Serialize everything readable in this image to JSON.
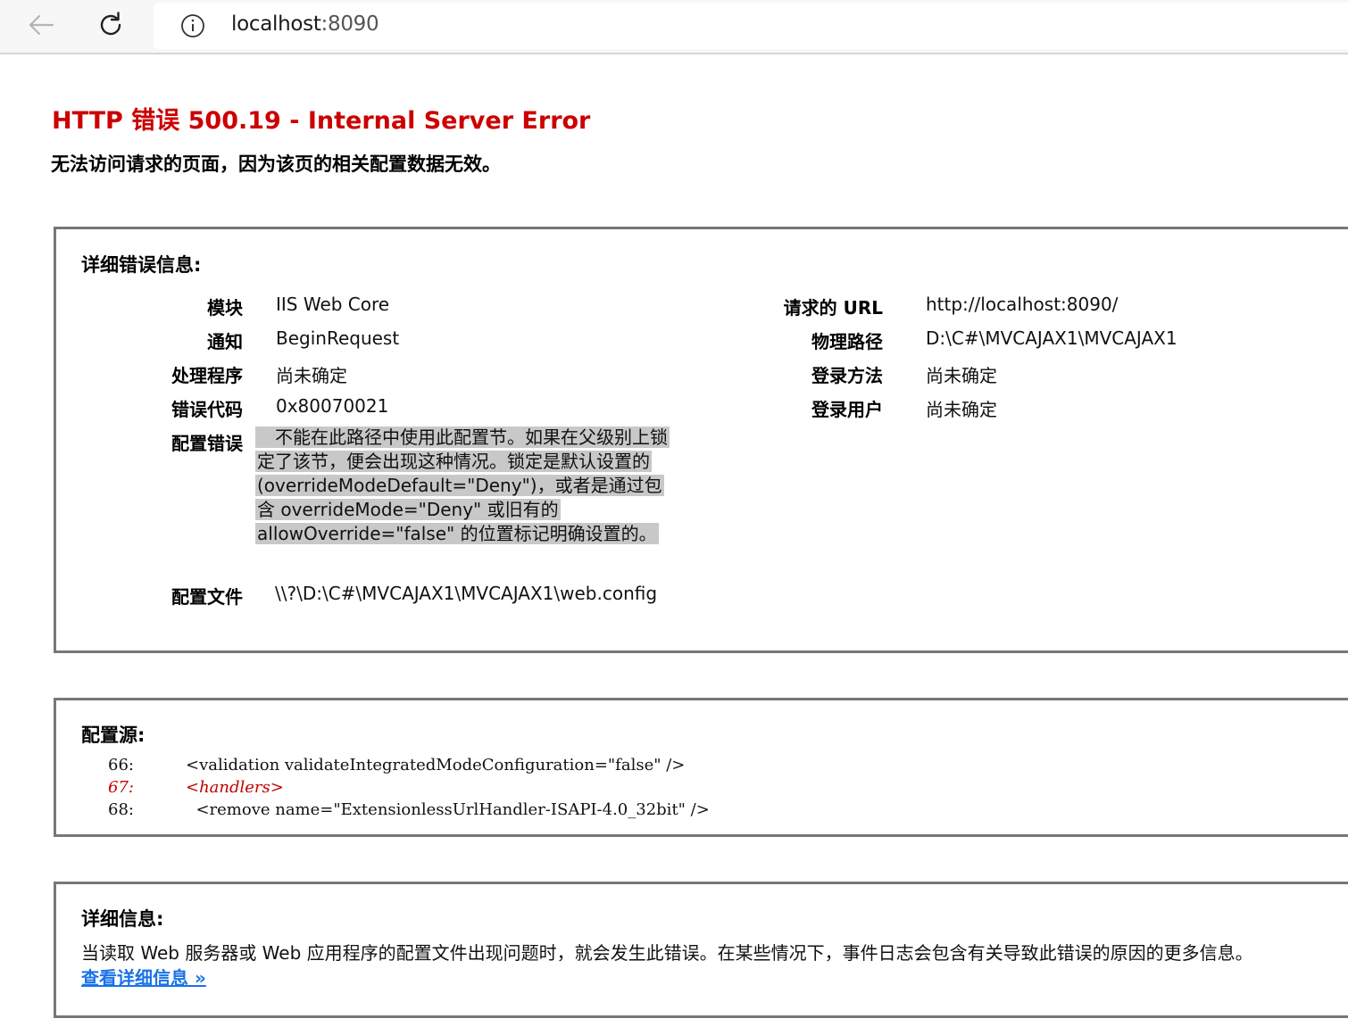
{
  "browser": {
    "address_host": "localhost",
    "address_port": ":8090"
  },
  "error": {
    "title": "HTTP 错误 500.19 - Internal Server Error",
    "subtitle": "无法访问请求的页面，因为该页的相关配置数据无效。"
  },
  "details": {
    "heading": "详细错误信息:",
    "left_fields": [
      {
        "label": "模块",
        "value": "IIS Web Core"
      },
      {
        "label": "通知",
        "value": "BeginRequest"
      },
      {
        "label": "处理程序",
        "value": "尚未确定"
      },
      {
        "label": "错误代码",
        "value": "0x80070021"
      }
    ],
    "config_error_label": "配置错误",
    "config_error_text": "不能在此路径中使用此配置节。如果在父级别上锁定了该节，便会出现这种情况。锁定是默认设置的(overrideModeDefault=\"Deny\")，或者是通过包含 overrideMode=\"Deny\" 或旧有的 allowOverride=\"false\" 的位置标记明确设置的。",
    "config_file_label": "配置文件",
    "config_file_value": "\\\\?\\D:\\C#\\MVCAJAX1\\MVCAJAX1\\web.config",
    "right_fields": [
      {
        "label": "请求的 URL",
        "value": "http://localhost:8090/"
      },
      {
        "label": "物理路径",
        "value": "D:\\C#\\MVCAJAX1\\MVCAJAX1"
      },
      {
        "label": "登录方法",
        "value": "尚未确定"
      },
      {
        "label": "登录用户",
        "value": "尚未确定"
      }
    ]
  },
  "config_source": {
    "heading": "配置源:",
    "lines": [
      {
        "num": "66:",
        "code": "<validation validateIntegratedModeConfiguration=\"false\" />"
      },
      {
        "num": "67:",
        "code": "<handlers>"
      },
      {
        "num": "68:",
        "code": "  <remove name=\"ExtensionlessUrlHandler-ISAPI-4.0_32bit\" />"
      }
    ]
  },
  "more_info": {
    "heading": "详细信息:",
    "text": "当读取 Web 服务器或 Web 应用程序的配置文件出现问题时，就会发生此错误。在某些情况下，事件日志会包含有关导致此错误的原因的更多信息。",
    "link": "查看详细信息 »"
  },
  "colors": {
    "error_red": "#cc0000",
    "link_blue": "#1a73e8",
    "highlight_gray": "#c8c8c8"
  }
}
